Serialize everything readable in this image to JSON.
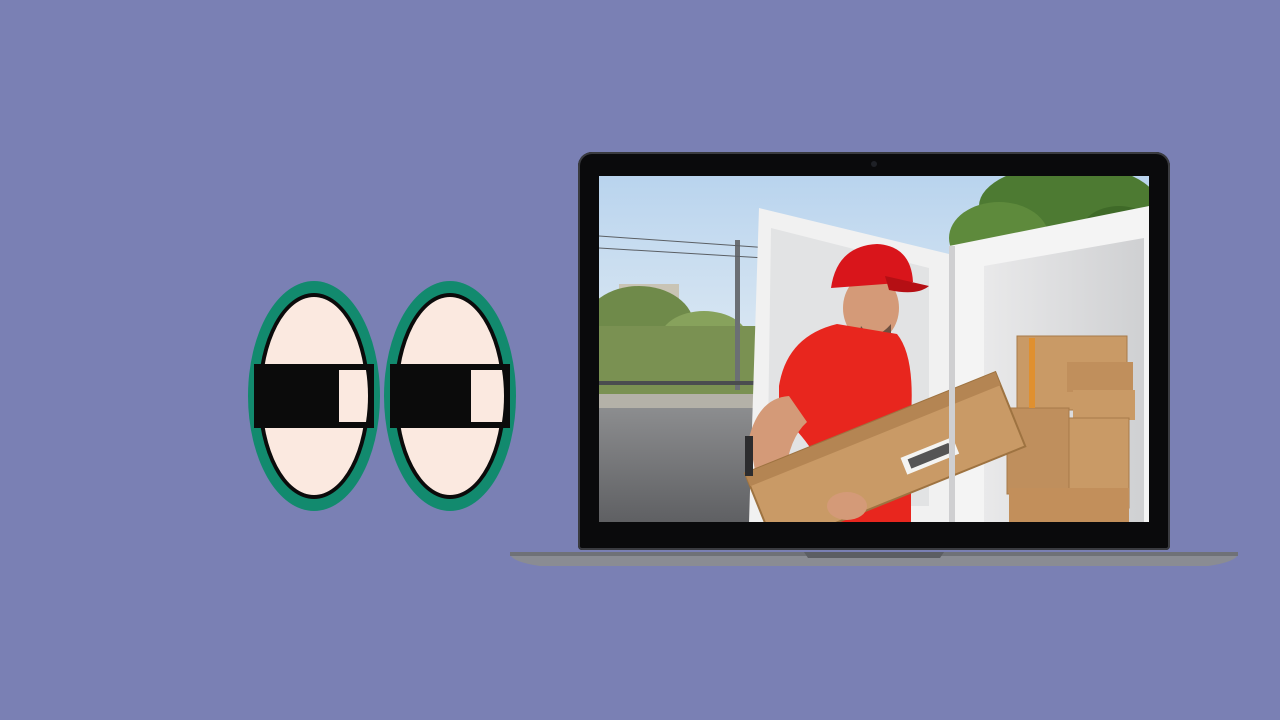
{
  "scene": {
    "background_color": "#7a80b4",
    "eyes": {
      "rim_color": "#128a6e",
      "sclera_color": "#fbe9e0",
      "pupil_band_color": "#0b0b0b"
    },
    "laptop": {
      "bezel_color": "#0a0a0c",
      "base_color": "#8a8c93",
      "screen_image": {
        "subject": "delivery-worker-carrying-box-icon",
        "cap_color": "#d9151b",
        "shirt_color": "#e8261e",
        "box_color": "#c99a66"
      }
    }
  }
}
